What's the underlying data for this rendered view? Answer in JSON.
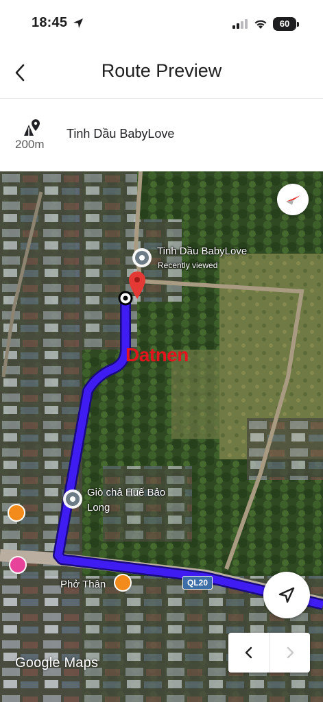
{
  "status_bar": {
    "time": "18:45",
    "battery": "60"
  },
  "header": {
    "title": "Route Preview"
  },
  "route_step": {
    "distance": "200m",
    "street": "Tinh Dầu BabyLove"
  },
  "map": {
    "places": [
      {
        "name": "Tinh Dầu BabyLove",
        "sub": "Recently viewed"
      },
      {
        "name_line1": "Giò chả Huế Bảo",
        "name_line2": "Long"
      },
      {
        "name": "Phở Thân"
      }
    ],
    "road_badge": "QL20",
    "watermark": "Datnen",
    "logo": "Google Maps",
    "route_color": "#3f1cf2",
    "destination_pin_color": "#e53935"
  }
}
